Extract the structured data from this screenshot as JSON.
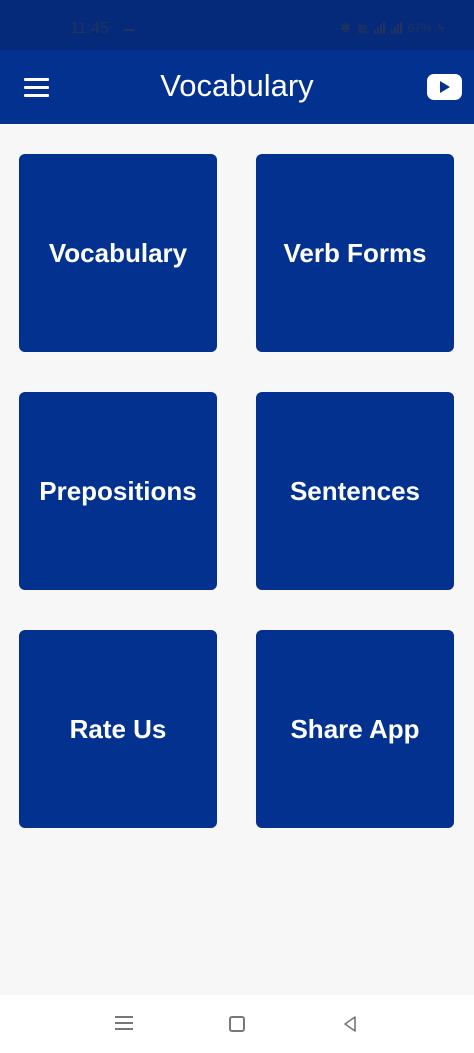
{
  "status_bar": {
    "time": "11:45",
    "battery": "67%"
  },
  "app_bar": {
    "title": "Vocabulary",
    "menu_icon": "hamburger-menu-icon",
    "action_icon": "youtube-icon"
  },
  "tiles": [
    {
      "label": "Vocabulary"
    },
    {
      "label": "Verb Forms"
    },
    {
      "label": "Prepositions"
    },
    {
      "label": "Sentences"
    },
    {
      "label": "Rate Us"
    },
    {
      "label": "Share App"
    }
  ],
  "nav_bar": {
    "icons": [
      "recent-apps-icon",
      "home-icon",
      "back-icon"
    ]
  },
  "colors": {
    "primary": "#02318f",
    "status_bar": "#052a7a",
    "background": "#f7f7f7",
    "tile_text": "#ffffff"
  }
}
